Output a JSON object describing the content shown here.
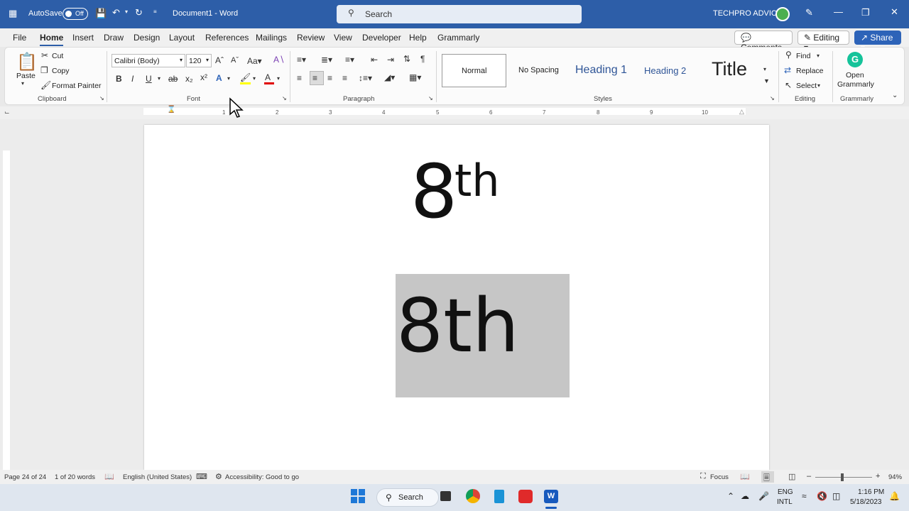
{
  "titlebar": {
    "autosave": "AutoSave",
    "toggle": "Off",
    "doc_title": "Document1 - Word",
    "search_placeholder": "Search",
    "user": "TECHPRO ADVICE"
  },
  "menu": {
    "items": [
      "File",
      "Home",
      "Insert",
      "Draw",
      "Design",
      "Layout",
      "References",
      "Mailings",
      "Review",
      "View",
      "Developer",
      "Help",
      "Grammarly"
    ],
    "comments": "Comments",
    "editing": "Editing",
    "share": "Share"
  },
  "clipboard": {
    "paste": "Paste",
    "cut": "Cut",
    "copy": "Copy",
    "format_painter": "Format Painter",
    "label": "Clipboard"
  },
  "font": {
    "name": "Calibri (Body)",
    "size": "120",
    "label": "Font"
  },
  "paragraph": {
    "label": "Paragraph"
  },
  "styles": {
    "normal": "Normal",
    "no_spacing": "No Spacing",
    "heading1": "Heading 1",
    "heading2": "Heading 2",
    "title": "Title",
    "label": "Styles"
  },
  "editing": {
    "find": "Find",
    "replace": "Replace",
    "select": "Select",
    "label": "Editing"
  },
  "grammarly": {
    "open": "Open",
    "name": "Grammarly",
    "label": "Grammarly"
  },
  "ruler": {
    "ticks": [
      "1",
      "2",
      "3",
      "4",
      "5",
      "6",
      "7",
      "8",
      "9",
      "10"
    ]
  },
  "document": {
    "line1_base": "8",
    "line1_sup": "th",
    "line2": "8th"
  },
  "status": {
    "page": "Page 24 of 24",
    "words": "1 of 20 words",
    "language": "English (United States)",
    "accessibility": "Accessibility: Good to go",
    "focus": "Focus",
    "zoom": "94%"
  },
  "taskbar": {
    "search": "Search",
    "lang1": "ENG",
    "lang2": "INTL",
    "time": "1:16 PM",
    "date": "5/18/2023"
  },
  "colors": {
    "accent": "#2d5ea8",
    "highlight": "#ffff00",
    "font_color": "#e00000",
    "grammarly": "#15c39a"
  }
}
